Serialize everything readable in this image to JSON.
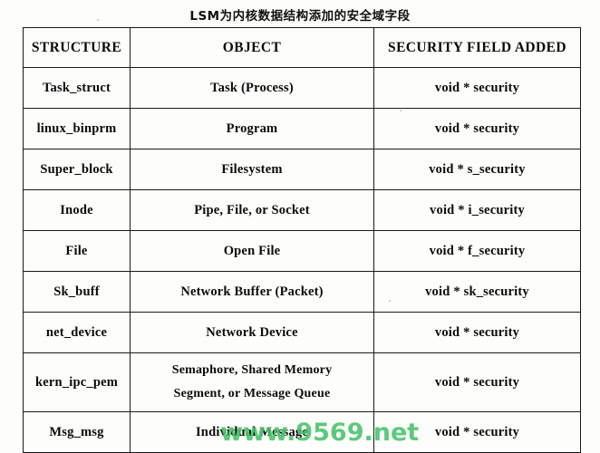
{
  "document": {
    "title": "LSM为内核数据结构添加的安全域字段",
    "watermark": "www.9569.net",
    "watermark_color": "#46c46a"
  },
  "table": {
    "headers": {
      "structure": "STRUCTURE",
      "object": "OBJECT",
      "security_field": "SECURITY FIELD ADDED"
    },
    "rows": [
      {
        "structure": "Task_struct",
        "object": "Task (Process)",
        "security_field": "void * security"
      },
      {
        "structure": "linux_binprm",
        "object": "Program",
        "security_field": "void * security"
      },
      {
        "structure": "Super_block",
        "object": "Filesystem",
        "security_field": "void * s_security"
      },
      {
        "structure": "Inode",
        "object": "Pipe, File, or Socket",
        "security_field": "void * i_security"
      },
      {
        "structure": "File",
        "object": "Open File",
        "security_field": "void * f_security"
      },
      {
        "structure": "Sk_buff",
        "object": "Network Buffer (Packet)",
        "security_field": "void * sk_security"
      },
      {
        "structure": "net_device",
        "object": "Network Device",
        "security_field": "void * security"
      },
      {
        "structure": "kern_ipc_pem",
        "object_line1": "Semaphore, Shared Memory",
        "object_line2": "Segment, or Message Queue",
        "security_field": "void * security"
      },
      {
        "structure": "Msg_msg",
        "object": "Individual Message",
        "security_field": "void * security"
      }
    ]
  }
}
